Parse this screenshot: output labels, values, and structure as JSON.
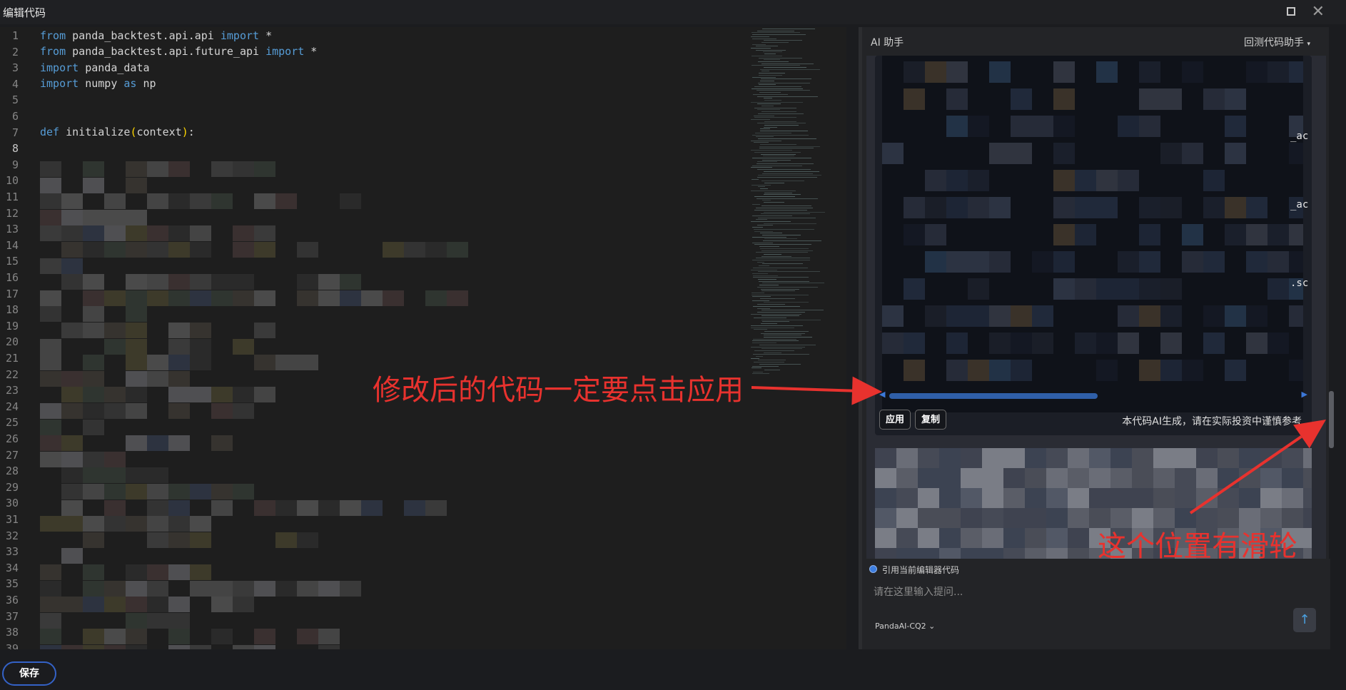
{
  "window": {
    "title": "编辑代码",
    "maximize_icon": "maximize-icon",
    "close_icon": "close-icon"
  },
  "editor": {
    "line_numbers": [
      "1",
      "2",
      "3",
      "4",
      "5",
      "6",
      "7",
      "8",
      "9",
      "10",
      "11",
      "12",
      "13",
      "14",
      "15",
      "16",
      "17",
      "18",
      "19",
      "20",
      "21",
      "22",
      "23",
      "24",
      "25",
      "26",
      "27",
      "28",
      "29",
      "30",
      "31",
      "32",
      "33",
      "34",
      "35",
      "36",
      "37",
      "38",
      "39"
    ],
    "active_line": 8,
    "code": {
      "l1": {
        "kw1": "from",
        "mid": " panda_backtest.api.api ",
        "kw2": "import",
        "end": " *"
      },
      "l2": {
        "kw1": "from",
        "mid": " panda_backtest.api.future_api ",
        "kw2": "import",
        "end": " *"
      },
      "l3": {
        "kw1": "import",
        "end": " panda_data"
      },
      "l4": {
        "kw1": "import",
        "mid": " numpy ",
        "kw2": "as",
        "end": " np"
      },
      "l7": {
        "kw1": "def",
        "mid": " initialize",
        "p1": "(",
        "arg": "context",
        "p2": ")",
        "end": ":"
      }
    }
  },
  "ai_panel": {
    "title": "AI 助手",
    "assistant_selector": "回测代码助手",
    "code_tail_1": "_ac",
    "code_tail_2": "_ac",
    "code_tail_3": ".sc",
    "apply_button": "应用",
    "copy_button": "复制",
    "disclaimer": "本代码AI生成，请在实际投资中谨慎参考",
    "include_code_label": "引用当前编辑器代码",
    "prompt_placeholder": "请在这里输入提问...",
    "model_selector": "PandaAI-CQ2",
    "send_icon": "arrow-up-icon"
  },
  "bottom": {
    "save_button": "保存"
  },
  "annotations": {
    "apply_note": "修改后的代码一定要点击应用",
    "scroll_note": "这个位置有滑轮",
    "color": "#e8322e"
  }
}
